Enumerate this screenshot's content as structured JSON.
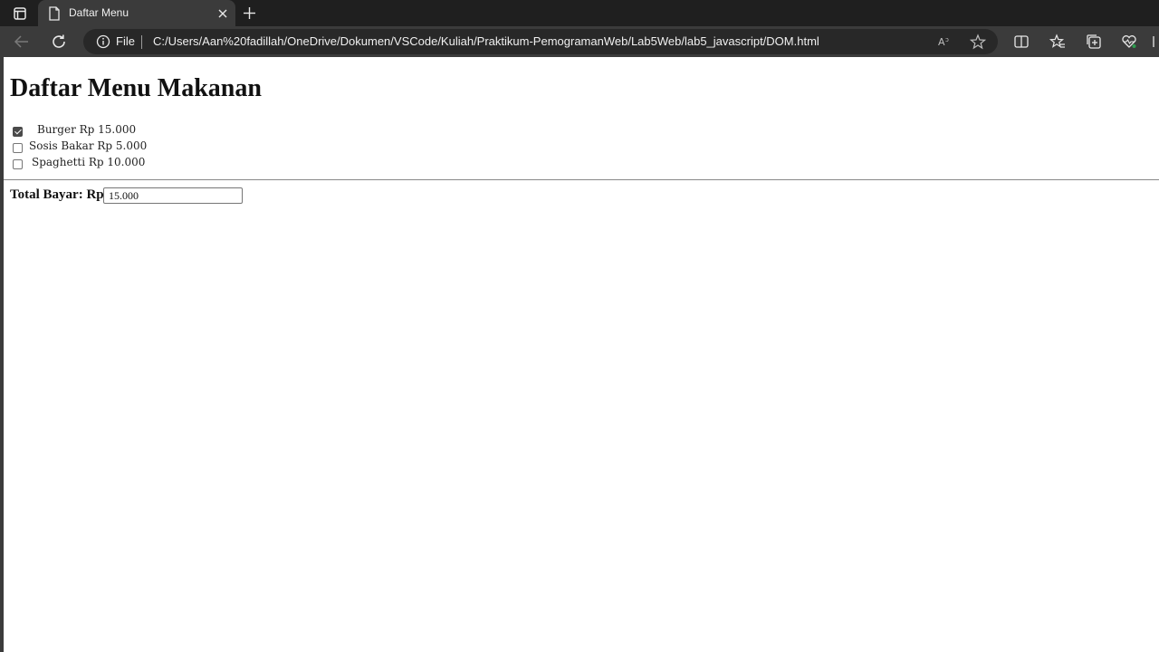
{
  "browser": {
    "tab_title": "Daftar Menu",
    "address_scheme": "File",
    "url": "C:/Users/Aan%20fadillah/OneDrive/Dokumen/VSCode/Kuliah/Praktikum-PemogramanWeb/Lab5Web/lab5_javascript/DOM.html"
  },
  "page": {
    "title": "Daftar Menu Makanan",
    "menu_items": [
      {
        "label": "Burger Rp 15.000",
        "checked": true
      },
      {
        "label": "Sosis Bakar Rp 5.000",
        "checked": false
      },
      {
        "label": "Spaghetti Rp 10.000",
        "checked": false
      }
    ],
    "total_label": "Total Bayar: Rp",
    "total_value": "15.000"
  },
  "colors": {
    "chrome_dark": "#1f1f1f",
    "chrome_toolbar": "#3b3b3b",
    "address_bg": "#282828"
  }
}
